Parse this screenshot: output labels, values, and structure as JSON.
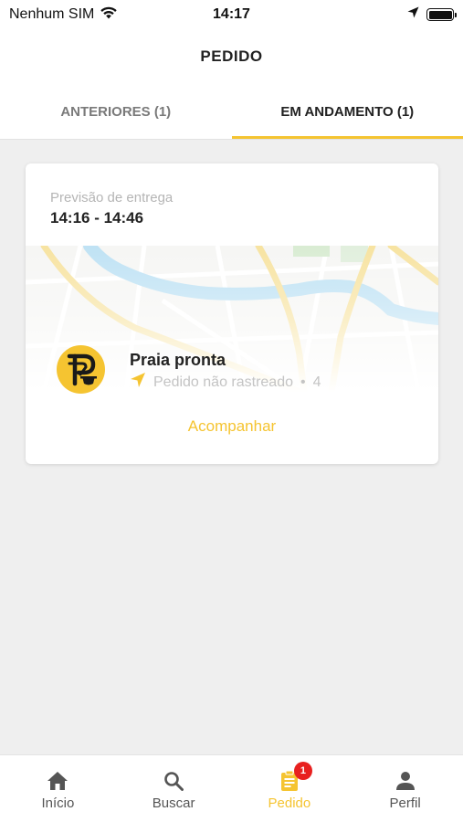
{
  "status_bar": {
    "carrier": "Nenhum SIM",
    "time": "14:17",
    "icons": [
      "wifi-icon",
      "location-arrow-icon",
      "battery-icon"
    ]
  },
  "header": {
    "title": "PEDIDO"
  },
  "tabs": [
    {
      "label": "ANTERIORES (1)",
      "active": false
    },
    {
      "label": "EM ANDAMENTO (1)",
      "active": true
    }
  ],
  "order_card": {
    "eta_label": "Previsão de entrega",
    "eta_value": "14:16 - 14:46",
    "store_name": "Praia pronta",
    "tracking_status": "Pedido não rastreado",
    "tracking_separator": "•",
    "tracking_count": "4",
    "follow_label": "Acompanhar",
    "store_logo_icon": "store-logo-icon",
    "tracking_icon": "navigation-arrow-icon"
  },
  "bottom_nav": {
    "items": [
      {
        "label": "Início",
        "icon": "home-icon",
        "active": false
      },
      {
        "label": "Buscar",
        "icon": "search-icon",
        "active": false
      },
      {
        "label": "Pedido",
        "icon": "clipboard-icon",
        "active": true,
        "badge": "1"
      },
      {
        "label": "Perfil",
        "icon": "person-icon",
        "active": false
      }
    ]
  },
  "colors": {
    "accent": "#f5c431",
    "badge": "#e8201f",
    "background": "#efefef",
    "map_river": "#bfe2f4",
    "map_road": "#f7e3a1"
  }
}
